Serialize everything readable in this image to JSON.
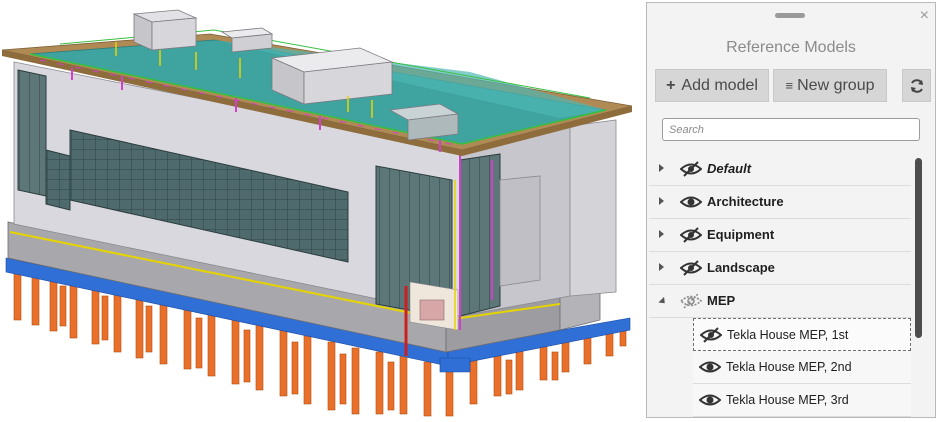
{
  "panel": {
    "title": "Reference Models",
    "close_glyph": "×",
    "add_model_label": "Add model",
    "new_group_label": "New group",
    "search_placeholder": "Search",
    "icons": {
      "add": "plus-icon",
      "group": "list-icon",
      "refresh": "refresh-icon",
      "visible": "eye-icon",
      "hidden": "eye-slash-icon"
    },
    "groups": [
      {
        "label": "Default",
        "italic": true,
        "visibility": "hidden",
        "expanded": false
      },
      {
        "label": "Architecture",
        "italic": false,
        "visibility": "visible",
        "expanded": false
      },
      {
        "label": "Equipment",
        "italic": false,
        "visibility": "hidden",
        "expanded": false
      },
      {
        "label": "Landscape",
        "italic": false,
        "visibility": "hidden",
        "expanded": false
      },
      {
        "label": "MEP",
        "italic": false,
        "visibility": "partial",
        "expanded": true
      }
    ],
    "mep_models": [
      {
        "label": "Tekla House MEP, 1st",
        "visibility": "hidden",
        "selected": true
      },
      {
        "label": "Tekla House MEP, 2nd",
        "visibility": "visible",
        "selected": false
      },
      {
        "label": "Tekla House MEP, 3rd",
        "visibility": "visible",
        "selected": false
      }
    ]
  },
  "colors": {
    "roof_edge": "#b08a54",
    "roof_deck": "#3fa3a0",
    "wall": "#d8d8de",
    "glass": "#4f6a6c",
    "foundation_beam": "#2f6fd6",
    "piles": "#e8702a",
    "panel_bg": "#f3f3f3"
  }
}
